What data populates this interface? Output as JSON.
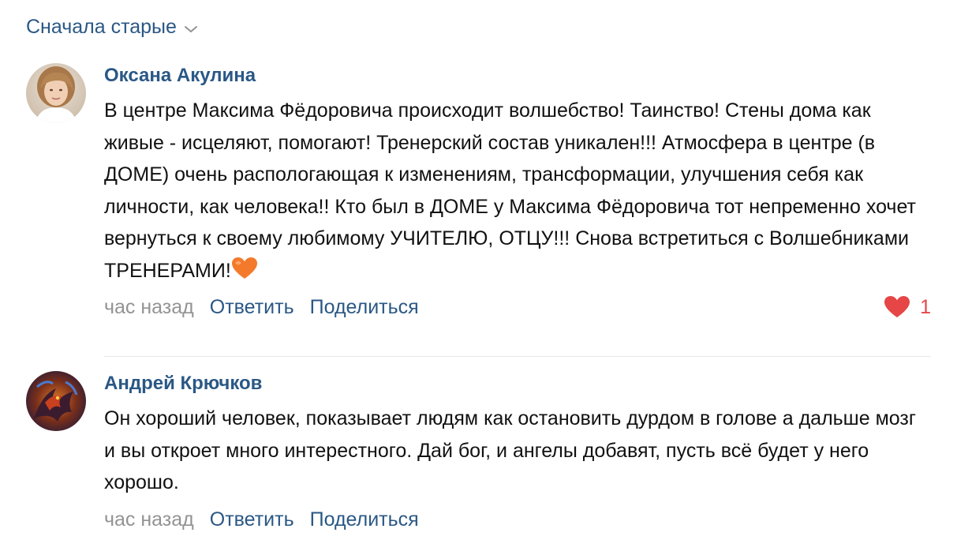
{
  "sort": {
    "label": "Сначала старые",
    "icon": "chevron-down-icon"
  },
  "comments": [
    {
      "author": "Оксана Акулина",
      "text": "В центре Максима Фёдоровича происходит волшебство! Таинство! Стены дома как живые - исцеляют, помогают! Тренерский состав уникален!!! Атмосфера в центре (в ДОМЕ) очень распологающая к изменениям, трансформации, улучшения себя как личности, как человека!! Кто был в ДОМЕ у Максима Фёдоровича тот непременно хочет вернуться к своему любимому УЧИТЕЛЮ, ОТЦУ!!! Снова встретиться с Волшебниками ТРЕНЕРАМИ!",
      "emoji": "orange-heart-emoji",
      "time": "час назад",
      "reply_label": "Ответить",
      "share_label": "Поделиться",
      "likes": "1",
      "like_icon": "heart-icon"
    },
    {
      "author": "Андрей Крючков",
      "text": "Он хороший человек, показывает людям как остановить дурдом в голове а дальше мозг и вы откроет много интерестного. Дай бог, и ангелы добавят, пусть всё будет у него хорошо.",
      "time": "час назад",
      "reply_label": "Ответить",
      "share_label": "Поделиться"
    }
  ],
  "colors": {
    "link": "#2a5885",
    "muted": "#939393",
    "like": "#e64646",
    "divider": "#e7e8ec"
  }
}
